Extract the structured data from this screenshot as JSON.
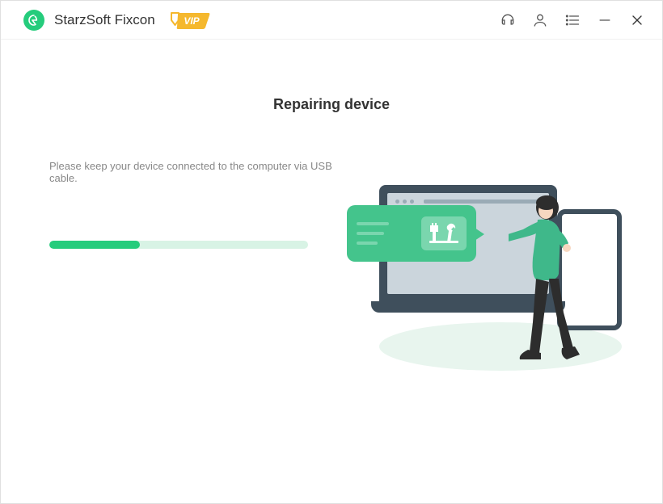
{
  "header": {
    "app_title": "StarzSoft Fixcon",
    "vip_label": "VIP"
  },
  "main": {
    "heading": "Repairing device",
    "instruction": "Please keep your device connected to the computer via USB cable.",
    "progress_percent": 35
  },
  "colors": {
    "accent": "#25cc7c",
    "vip_gold": "#f5b82e"
  }
}
